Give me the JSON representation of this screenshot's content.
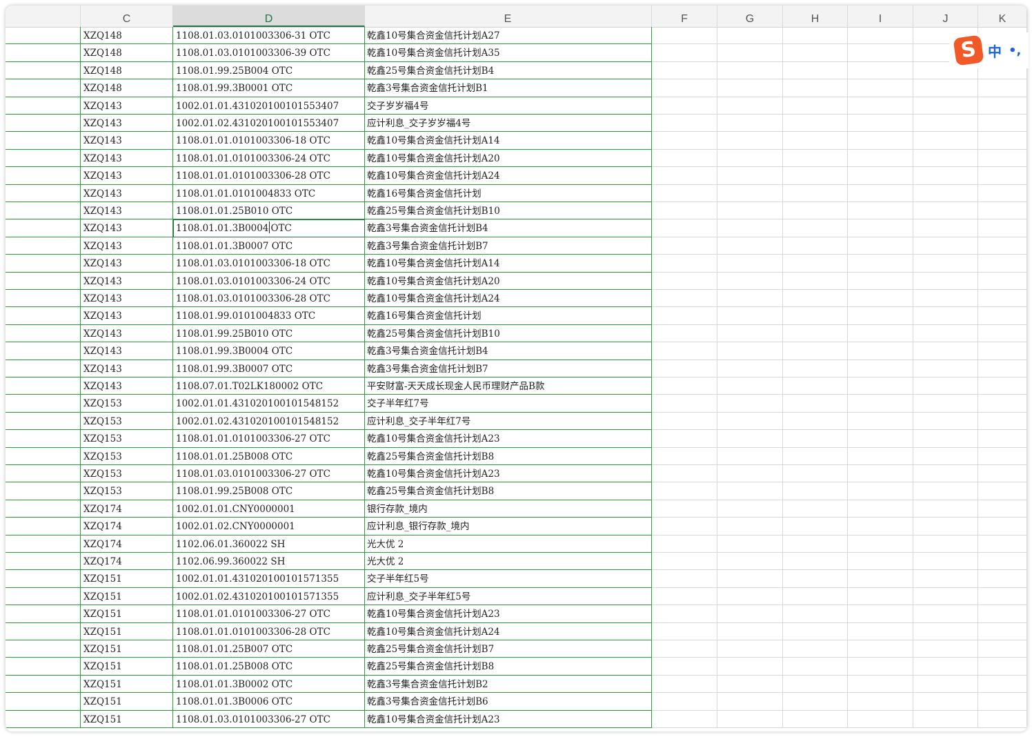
{
  "columns": [
    "C",
    "D",
    "E",
    "F",
    "G",
    "H",
    "I",
    "J",
    "K"
  ],
  "active_column": "D",
  "rows": [
    [
      "XZQ148",
      "1108.01.03.0101003306-31 OTC",
      "乾鑫10号集合资金信托计划A27"
    ],
    [
      "XZQ148",
      "1108.01.03.0101003306-39 OTC",
      "乾鑫10号集合资金信托计划A35"
    ],
    [
      "XZQ148",
      "1108.01.99.25B004 OTC",
      "乾鑫25号集合资金信托计划B4"
    ],
    [
      "XZQ148",
      "1108.01.99.3B0001 OTC",
      "乾鑫3号集合资金信托计划B1"
    ],
    [
      "XZQ143",
      "1002.01.01.431020100101553407",
      "交子岁岁福4号"
    ],
    [
      "XZQ143",
      "1002.01.02.431020100101553407",
      "应计利息_交子岁岁福4号"
    ],
    [
      "XZQ143",
      "1108.01.01.0101003306-18 OTC",
      "乾鑫10号集合资金信托计划A14"
    ],
    [
      "XZQ143",
      "1108.01.01.0101003306-24 OTC",
      "乾鑫10号集合资金信托计划A20"
    ],
    [
      "XZQ143",
      "1108.01.01.0101003306-28 OTC",
      "乾鑫10号集合资金信托计划A24"
    ],
    [
      "XZQ143",
      "1108.01.01.0101004833 OTC",
      "乾鑫16号集合资金信托计划"
    ],
    [
      "XZQ143",
      "1108.01.01.25B010 OTC",
      "乾鑫25号集合资金信托计划B10"
    ],
    [
      "XZQ143",
      "1108.01.01.3B0004 OTC",
      "乾鑫3号集合资金信托计划B4"
    ],
    [
      "XZQ143",
      "1108.01.01.3B0007 OTC",
      "乾鑫3号集合资金信托计划B7"
    ],
    [
      "XZQ143",
      "1108.01.03.0101003306-18 OTC",
      "乾鑫10号集合资金信托计划A14"
    ],
    [
      "XZQ143",
      "1108.01.03.0101003306-24 OTC",
      "乾鑫10号集合资金信托计划A20"
    ],
    [
      "XZQ143",
      "1108.01.03.0101003306-28 OTC",
      "乾鑫10号集合资金信托计划A24"
    ],
    [
      "XZQ143",
      "1108.01.99.0101004833 OTC",
      "乾鑫16号集合资金信托计划"
    ],
    [
      "XZQ143",
      "1108.01.99.25B010 OTC",
      "乾鑫25号集合资金信托计划B10"
    ],
    [
      "XZQ143",
      "1108.01.99.3B0004 OTC",
      "乾鑫3号集合资金信托计划B4"
    ],
    [
      "XZQ143",
      "1108.01.99.3B0007 OTC",
      "乾鑫3号集合资金信托计划B7"
    ],
    [
      "XZQ143",
      "1108.07.01.T02LK180002 OTC",
      "平安财富-天天成长现金人民币理财产品B款"
    ],
    [
      "XZQ153",
      "1002.01.01.431020100101548152",
      "交子半年红7号"
    ],
    [
      "XZQ153",
      "1002.01.02.431020100101548152",
      "应计利息_交子半年红7号"
    ],
    [
      "XZQ153",
      "1108.01.01.0101003306-27 OTC",
      "乾鑫10号集合资金信托计划A23"
    ],
    [
      "XZQ153",
      "1108.01.01.25B008 OTC",
      "乾鑫25号集合资金信托计划B8"
    ],
    [
      "XZQ153",
      "1108.01.03.0101003306-27 OTC",
      "乾鑫10号集合资金信托计划A23"
    ],
    [
      "XZQ153",
      "1108.01.99.25B008 OTC",
      "乾鑫25号集合资金信托计划B8"
    ],
    [
      "XZQ174",
      "1002.01.01.CNY0000001",
      "银行存款_境内"
    ],
    [
      "XZQ174",
      "1002.01.02.CNY0000001",
      "应计利息_银行存款_境内"
    ],
    [
      "XZQ174",
      "1102.06.01.360022 SH",
      "光大优 2"
    ],
    [
      "XZQ174",
      "1102.06.99.360022 SH",
      "光大优 2"
    ],
    [
      "XZQ151",
      "1002.01.01.431020100101571355",
      "交子半年红5号"
    ],
    [
      "XZQ151",
      "1002.01.02.431020100101571355",
      "应计利息_交子半年红5号"
    ],
    [
      "XZQ151",
      "1108.01.01.0101003306-27 OTC",
      "乾鑫10号集合资金信托计划A23"
    ],
    [
      "XZQ151",
      "1108.01.01.0101003306-28 OTC",
      "乾鑫10号集合资金信托计划A24"
    ],
    [
      "XZQ151",
      "1108.01.01.25B007 OTC",
      "乾鑫25号集合资金信托计划B7"
    ],
    [
      "XZQ151",
      "1108.01.01.25B008 OTC",
      "乾鑫25号集合资金信托计划B8"
    ],
    [
      "XZQ151",
      "1108.01.01.3B0002 OTC",
      "乾鑫3号集合资金信托计划B2"
    ],
    [
      "XZQ151",
      "1108.01.01.3B0006 OTC",
      "乾鑫3号集合资金信托计划B6"
    ],
    [
      "XZQ151",
      "1108.01.03.0101003306-27 OTC",
      "乾鑫10号集合资金信托计划A23"
    ]
  ],
  "selected_cell": {
    "row": 11,
    "column": "D"
  },
  "ime": {
    "logo_letter": "S",
    "mode": "中",
    "punct": "•,"
  },
  "colors": {
    "grid_border": "#2e9a3e",
    "accent": "#217346",
    "ime_logo": "#ef5a28",
    "ime_text": "#1a64d8"
  }
}
